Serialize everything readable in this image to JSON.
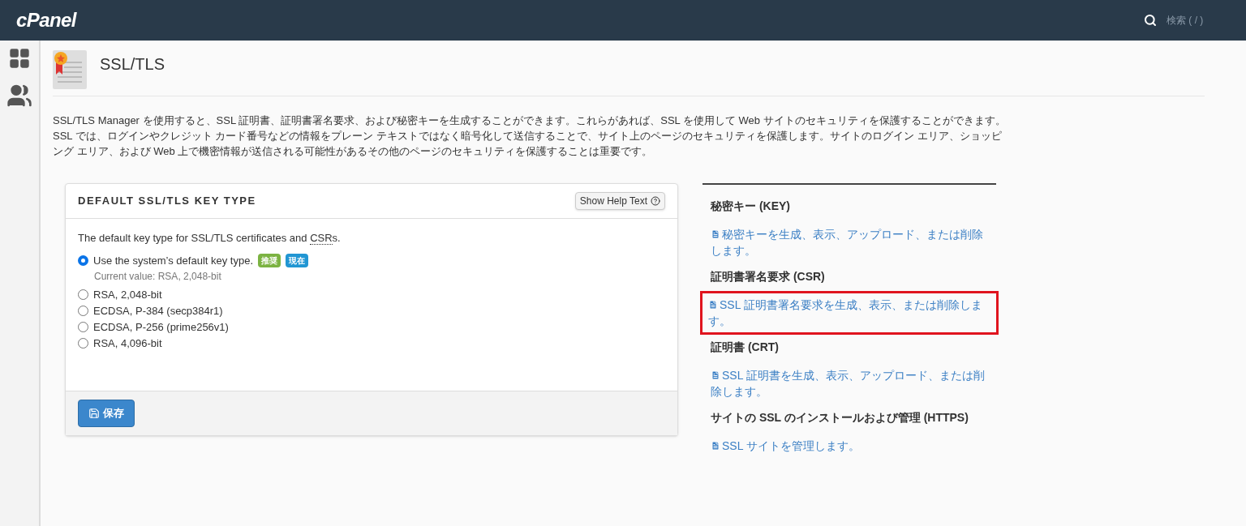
{
  "header": {
    "logo": "cPanel",
    "search_placeholder": "検索 ( / )"
  },
  "page": {
    "title": "SSL/TLS",
    "description": "SSL/TLS Manager を使用すると、SSL 証明書、証明書署名要求、および秘密キーを生成することができます。これらがあれば、SSL を使用して Web サイトのセキュリティを保護することができます。SSL では、ログインやクレジット カード番号などの情報をプレーン テキストではなく暗号化して送信することで、サイト上のページのセキュリティを保護します。サイトのログイン エリア、ショッピング エリア、および Web 上で機密情報が送信される可能性があるその他のページのセキュリティを保護することは重要です。"
  },
  "key_type_panel": {
    "title": "DEFAULT SSL/TLS KEY TYPE",
    "help_button": "Show Help Text",
    "intro_before": "The default key type for SSL/TLS certificates and ",
    "intro_abbr": "CSR",
    "intro_after": "s.",
    "options": [
      {
        "label": "Use the system’s default key type.",
        "selected": true,
        "badges": [
          {
            "text": "推奨",
            "color": "#7cb342"
          },
          {
            "text": "現在",
            "color": "#2196d3"
          }
        ],
        "note": "Current value: RSA, 2,048-bit"
      },
      {
        "label": "RSA, 2,048-bit",
        "selected": false
      },
      {
        "label": "ECDSA, P-384 (secp384r1)",
        "selected": false
      },
      {
        "label": "ECDSA, P-256 (prime256v1)",
        "selected": false
      },
      {
        "label": "RSA, 4,096-bit",
        "selected": false
      }
    ],
    "save_button": "保存"
  },
  "sections": [
    {
      "heading": "秘密キー (KEY)",
      "link": "秘密キーを生成、表示、アップロード、または削除します。",
      "highlighted": false
    },
    {
      "heading": "証明書署名要求 (CSR)",
      "link": "SSL 証明書署名要求を生成、表示、または削除します。",
      "highlighted": true
    },
    {
      "heading": "証明書 (CRT)",
      "link": "SSL 証明書を生成、表示、アップロード、または削除します。",
      "highlighted": false
    },
    {
      "heading": "サイトの SSL のインストールおよび管理 (HTTPS)",
      "link": "SSL サイトを管理します。",
      "highlighted": false
    }
  ]
}
